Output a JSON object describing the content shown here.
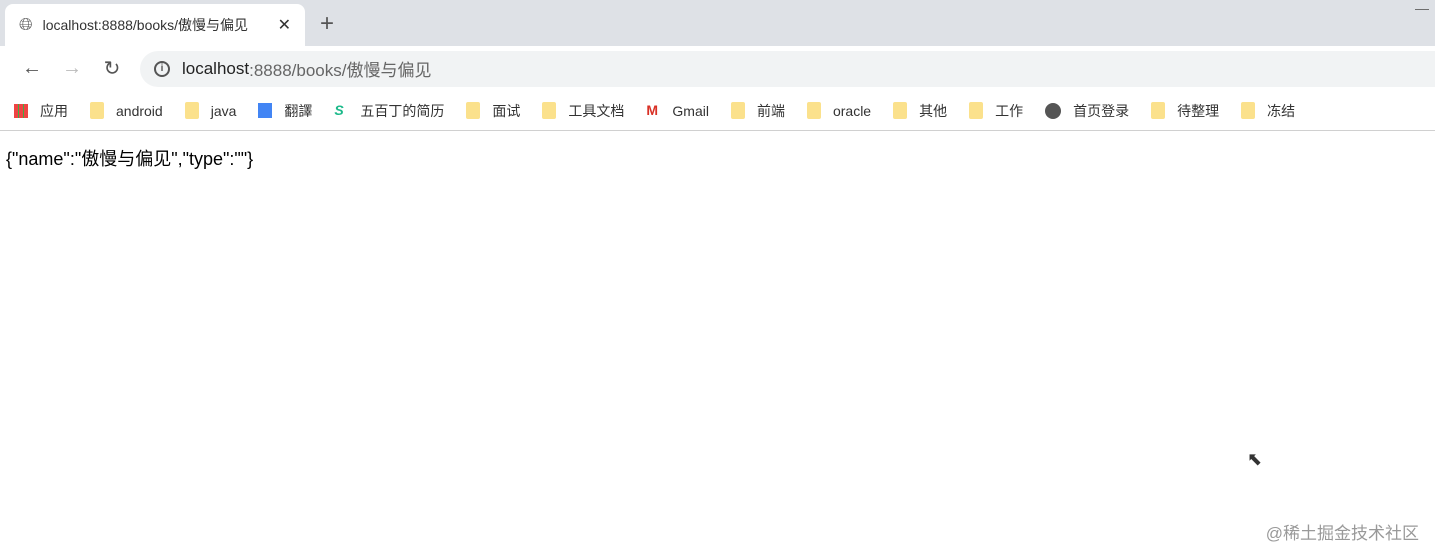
{
  "tab": {
    "title": "localhost:8888/books/傲慢与偏见",
    "close": "✕",
    "new_tab": "+"
  },
  "toolbar": {
    "back": "←",
    "forward": "→",
    "reload": "↻",
    "url_host": "localhost",
    "url_path": ":8888/books/傲慢与偏见"
  },
  "bookmarks": [
    {
      "label": "应用",
      "icon": "apps-grid"
    },
    {
      "label": "android",
      "icon": "folder"
    },
    {
      "label": "java",
      "icon": "folder"
    },
    {
      "label": "翻譯",
      "icon": "google-translate"
    },
    {
      "label": "五百丁的简历",
      "icon": "wubaiding"
    },
    {
      "label": "面试",
      "icon": "folder"
    },
    {
      "label": "工具文档",
      "icon": "folder"
    },
    {
      "label": "Gmail",
      "icon": "gmail"
    },
    {
      "label": "前端",
      "icon": "folder"
    },
    {
      "label": "oracle",
      "icon": "folder"
    },
    {
      "label": "其他",
      "icon": "folder"
    },
    {
      "label": "工作",
      "icon": "folder"
    },
    {
      "label": "首页登录",
      "icon": "globe"
    },
    {
      "label": "待整理",
      "icon": "folder"
    },
    {
      "label": "冻结",
      "icon": "folder"
    }
  ],
  "body_text": "{\"name\":\"傲慢与偏见\",\"type\":\"\"}",
  "watermark": "@稀土掘金技术社区"
}
